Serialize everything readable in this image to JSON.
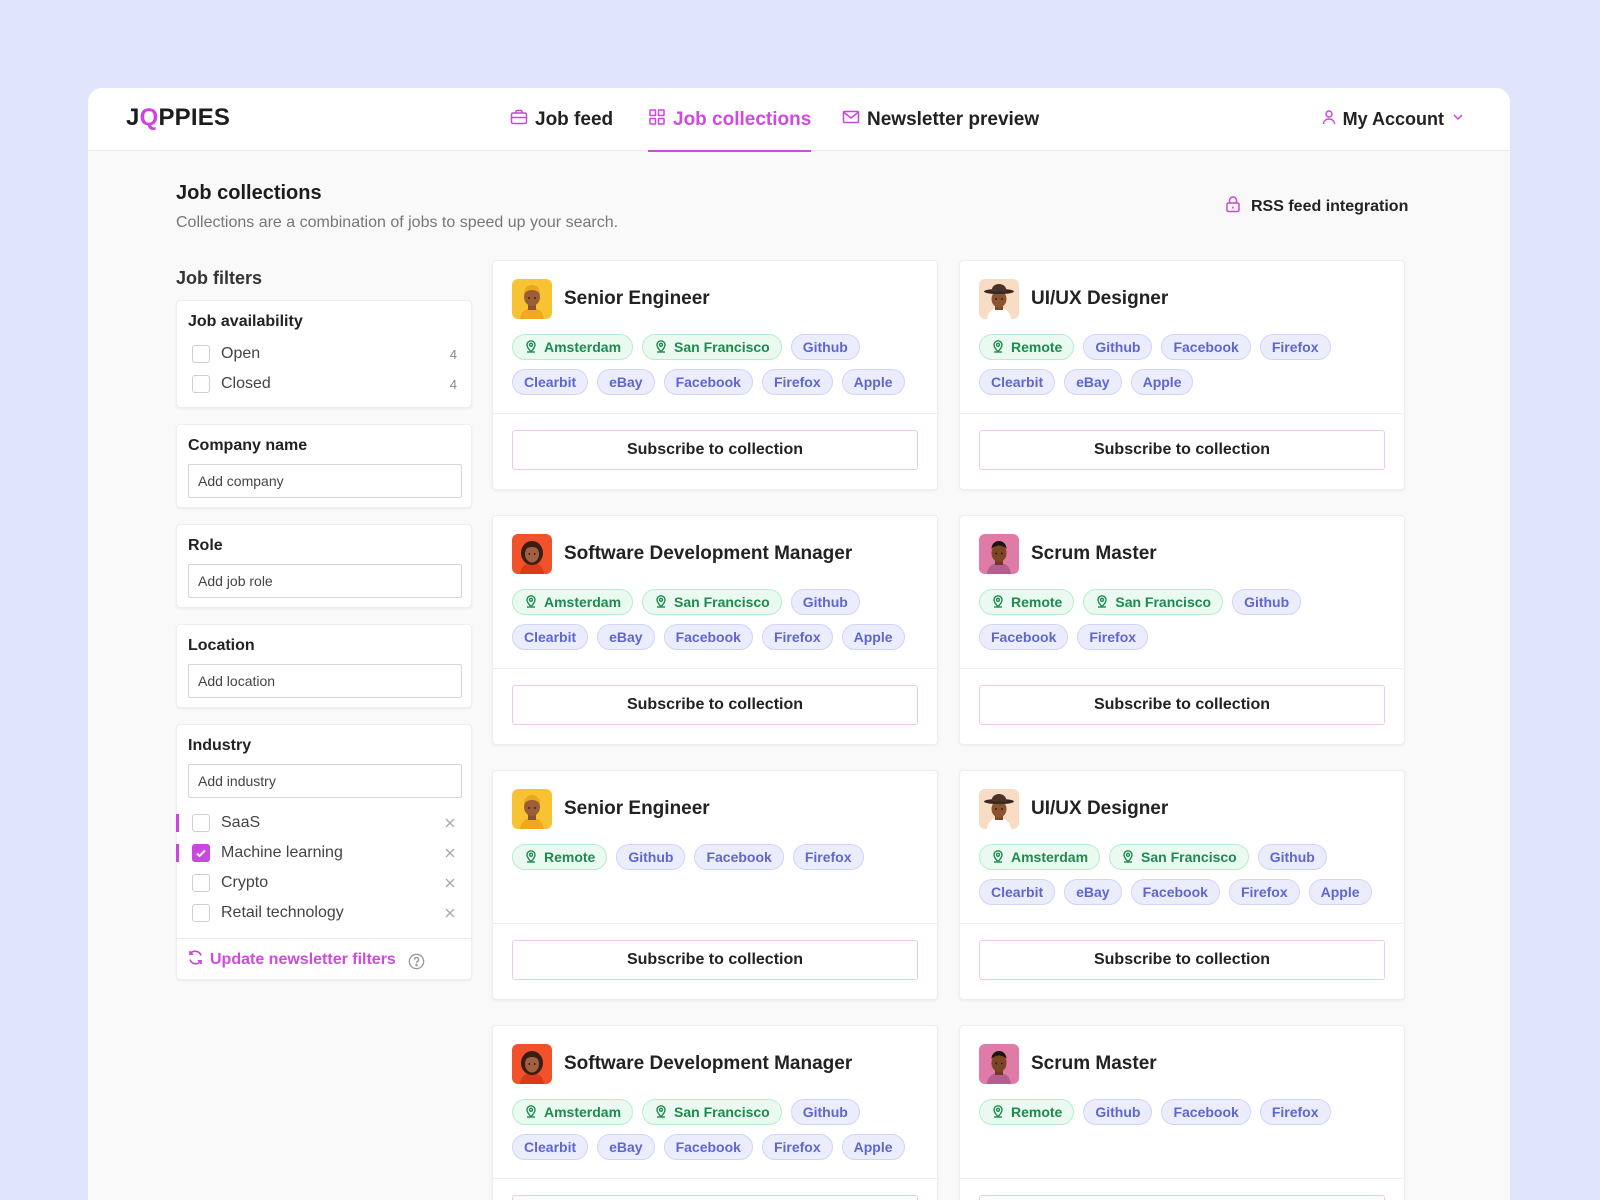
{
  "app": {
    "logo_prefix": "J",
    "logo_q": "Q",
    "logo_suffix": "PPIES"
  },
  "nav": {
    "items": [
      {
        "label": "Job feed",
        "icon": "briefcase-icon",
        "active": false
      },
      {
        "label": "Job collections",
        "icon": "grid-icon",
        "active": true
      },
      {
        "label": "Newsletter preview",
        "icon": "mail-icon",
        "active": false
      }
    ],
    "account": {
      "label": "My Account",
      "icon": "user-icon"
    }
  },
  "page": {
    "title": "Job collections",
    "subtitle": "Collections are a combination of jobs to speed up your search.",
    "rss_label": "RSS feed integration"
  },
  "filters": {
    "title": "Job filters",
    "availability": {
      "title": "Job availability",
      "options": [
        {
          "label": "Open",
          "count": "4",
          "checked": false
        },
        {
          "label": "Closed",
          "count": "4",
          "checked": false
        }
      ]
    },
    "company": {
      "title": "Company name",
      "placeholder": "Add company"
    },
    "role": {
      "title": "Role",
      "placeholder": "Add job role"
    },
    "location": {
      "title": "Location",
      "placeholder": "Add location"
    },
    "industry": {
      "title": "Industry",
      "placeholder": "Add industry",
      "options": [
        {
          "label": "SaaS",
          "checked": false
        },
        {
          "label": "Machine learning",
          "checked": true
        },
        {
          "label": "Crypto",
          "checked": false
        },
        {
          "label": "Retail technology",
          "checked": false
        }
      ]
    },
    "update_label": "Update newsletter filters"
  },
  "subscribe_label": "Subscribe to collection",
  "colors": {
    "accent": "#cc45de",
    "location_tag_text": "#1e8a4e",
    "company_tag_text": "#5e66d0",
    "background": "#e1e4fd"
  },
  "collections": [
    {
      "title": "Senior Engineer",
      "avatar": "avatar-yellow",
      "locations": [
        "Amsterdam",
        "San Francisco"
      ],
      "companies": [
        "Github",
        "Clearbit",
        "eBay",
        "Facebook",
        "Firefox",
        "Apple"
      ]
    },
    {
      "title": "UI/UX Designer",
      "avatar": "avatar-cowboy",
      "locations": [
        "Remote"
      ],
      "companies": [
        "Github",
        "Facebook",
        "Firefox",
        "Clearbit",
        "eBay",
        "Apple"
      ]
    },
    {
      "title": "Software Development Manager",
      "avatar": "avatar-orange",
      "locations": [
        "Amsterdam",
        "San Francisco"
      ],
      "companies": [
        "Github",
        "Clearbit",
        "eBay",
        "Facebook",
        "Firefox",
        "Apple"
      ]
    },
    {
      "title": "Scrum Master",
      "avatar": "avatar-pink",
      "locations": [
        "Remote",
        "San Francisco"
      ],
      "companies": [
        "Github",
        "Facebook",
        "Firefox"
      ]
    },
    {
      "title": "Senior Engineer",
      "avatar": "avatar-yellow",
      "locations": [
        "Remote"
      ],
      "companies": [
        "Github",
        "Facebook",
        "Firefox"
      ]
    },
    {
      "title": "UI/UX Designer",
      "avatar": "avatar-cowboy",
      "locations": [
        "Amsterdam",
        "San Francisco"
      ],
      "companies": [
        "Github",
        "Clearbit",
        "eBay",
        "Facebook",
        "Firefox",
        "Apple"
      ]
    },
    {
      "title": "Software Development Manager",
      "avatar": "avatar-orange",
      "locations": [
        "Amsterdam",
        "San Francisco"
      ],
      "companies": [
        "Github",
        "Clearbit",
        "eBay",
        "Facebook",
        "Firefox",
        "Apple"
      ]
    },
    {
      "title": "Scrum Master",
      "avatar": "avatar-pink",
      "locations": [
        "Remote"
      ],
      "companies": [
        "Github",
        "Facebook",
        "Firefox"
      ]
    }
  ]
}
